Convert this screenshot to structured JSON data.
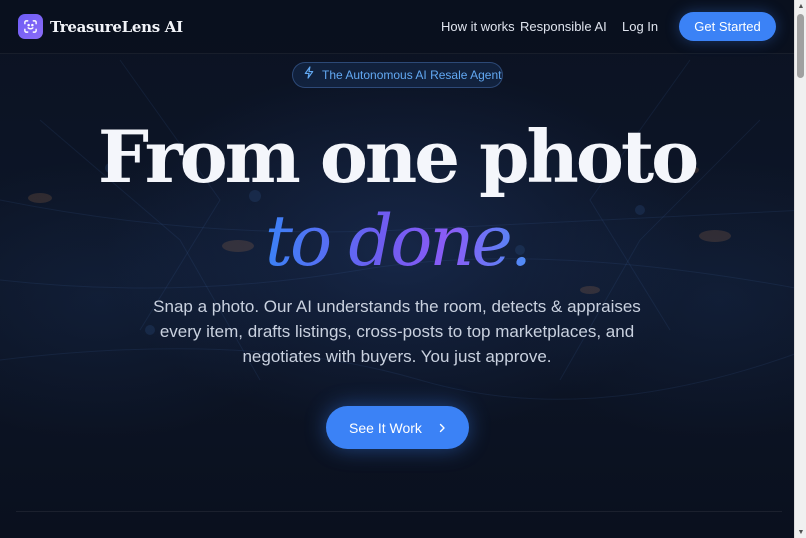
{
  "nav": {
    "logo_text": "TreasureLens AI",
    "links": [
      "How it works",
      "Responsible AI",
      "Log In"
    ],
    "cta": "Get Started"
  },
  "hero": {
    "badge": "The Autonomous AI Resale Agent",
    "headline_line1": "From one photo",
    "headline_line2": "to done.",
    "subtitle": "Snap a photo. Our AI understands the room, detects & appraises every item, drafts listings, cross-posts to top marketplaces, and negotiates with buyers. You just approve.",
    "cta": "See It Work"
  },
  "icons": {
    "logo": "scan-icon",
    "badge": "lightning-icon",
    "cta": "chevron-right-icon"
  },
  "colors": {
    "accent": "#3b82f6",
    "accent_purple": "#8b5cf6",
    "logo_purple": "#6d5cf6",
    "badge_text": "#62a8f2",
    "background": "#0a1020"
  }
}
